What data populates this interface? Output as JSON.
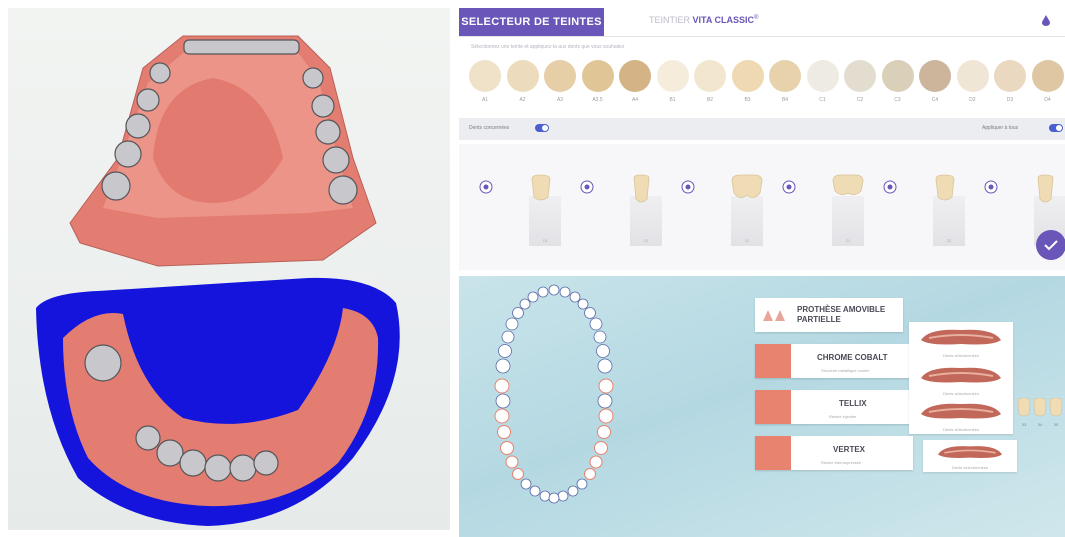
{
  "shade_selector": {
    "tab_active": "SELECTEUR DE TEINTES",
    "tab_inactive_prefix": "TEINTIER",
    "tab_inactive_brand": "VITA CLASSIC",
    "tab_inactive_sup": "®",
    "instruction": "Sélectionnez une teinte et appliquez-la aux dents que vous souhaitez",
    "shades": [
      {
        "label": "A1",
        "color": "#f0e2c8"
      },
      {
        "label": "A2",
        "color": "#ecdbbd"
      },
      {
        "label": "A3",
        "color": "#e6cfa6"
      },
      {
        "label": "A3.5",
        "color": "#e0c596"
      },
      {
        "label": "A4",
        "color": "#d4b387"
      },
      {
        "label": "B1",
        "color": "#f5ecdc"
      },
      {
        "label": "B2",
        "color": "#f3e6cf"
      },
      {
        "label": "B3",
        "color": "#eed9b2"
      },
      {
        "label": "B4",
        "color": "#e8d2ac"
      },
      {
        "label": "C1",
        "color": "#edebe3"
      },
      {
        "label": "C2",
        "color": "#e2ddce"
      },
      {
        "label": "C3",
        "color": "#dacfb8"
      },
      {
        "label": "C4",
        "color": "#cdb59c"
      },
      {
        "label": "D2",
        "color": "#efe6d6"
      },
      {
        "label": "D3",
        "color": "#ead9c0"
      },
      {
        "label": "D4",
        "color": "#e0c7a3"
      }
    ],
    "toggle_left_label": "Dents concernées",
    "toggle_right_label": "Appliquer à tous",
    "stands": [
      {
        "badge": "A3",
        "num": "13"
      },
      {
        "badge": "A3",
        "num": "12"
      },
      {
        "badge": "A3",
        "num": "11"
      },
      {
        "badge": "A3",
        "num": "21"
      },
      {
        "badge": "A3",
        "num": "22"
      },
      {
        "badge": "A3",
        "num": "23"
      }
    ],
    "confirm_icon": "check-icon"
  },
  "products": {
    "cards": [
      {
        "title_line1": "PROTHÈSE AMOVIBLE",
        "title_line2": "PARTIELLE",
        "sub": ""
      },
      {
        "title_line1": "CHROME COBALT",
        "title_line2": "",
        "sub": "Structure métallique coulée"
      },
      {
        "title_line1": "TELLIX",
        "title_line2": "",
        "sub": "Résine injectée"
      },
      {
        "title_line1": "VERTEX",
        "title_line2": "",
        "sub": "Résine thermopressée"
      }
    ],
    "thumbs": [
      {
        "caption": "Dents sélectionnées"
      },
      {
        "caption": "Dents sélectionnées"
      },
      {
        "caption": "Dents sélectionnées"
      },
      {
        "caption": "Dents sélectionnées"
      }
    ],
    "small_labels": [
      "33",
      "34",
      "35"
    ]
  },
  "colors": {
    "accent": "#6a55b8",
    "toggle": "#4a5fd0",
    "card_icon": "#e8836f",
    "scan_gum": "#e47d71",
    "scan_tray": "#1414dc"
  }
}
